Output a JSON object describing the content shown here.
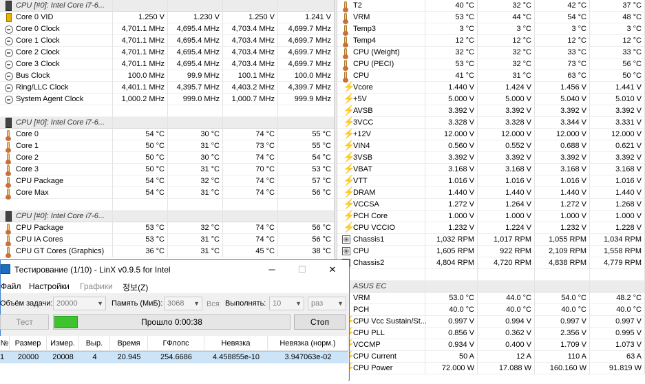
{
  "hwinfo_left": {
    "sections": [
      {
        "header": "CPU [#0]: Intel Core i7-6...",
        "rows": [
          {
            "icon": "vid",
            "label": "Core 0 VID",
            "v": [
              "1.250 V",
              "1.230 V",
              "1.250 V",
              "1.241 V"
            ]
          },
          {
            "icon": "clock",
            "label": "Core 0 Clock",
            "v": [
              "4,701.1 MHz",
              "4,695.4 MHz",
              "4,703.4 MHz",
              "4,699.7 MHz"
            ]
          },
          {
            "icon": "clock",
            "label": "Core 1 Clock",
            "v": [
              "4,701.1 MHz",
              "4,695.4 MHz",
              "4,703.4 MHz",
              "4,699.7 MHz"
            ]
          },
          {
            "icon": "clock",
            "label": "Core 2 Clock",
            "v": [
              "4,701.1 MHz",
              "4,695.4 MHz",
              "4,703.4 MHz",
              "4,699.7 MHz"
            ]
          },
          {
            "icon": "clock",
            "label": "Core 3 Clock",
            "v": [
              "4,701.1 MHz",
              "4,695.4 MHz",
              "4,703.4 MHz",
              "4,699.7 MHz"
            ]
          },
          {
            "icon": "clock",
            "label": "Bus Clock",
            "v": [
              "100.0 MHz",
              "99.9 MHz",
              "100.1 MHz",
              "100.0 MHz"
            ]
          },
          {
            "icon": "clock",
            "label": "Ring/LLC Clock",
            "v": [
              "4,401.1 MHz",
              "4,395.7 MHz",
              "4,403.2 MHz",
              "4,399.7 MHz"
            ]
          },
          {
            "icon": "clock",
            "label": "System Agent Clock",
            "v": [
              "1,000.2 MHz",
              "999.0 MHz",
              "1,000.7 MHz",
              "999.9 MHz"
            ]
          }
        ]
      },
      {
        "header": "CPU [#0]: Intel Core i7-6...",
        "rows": [
          {
            "icon": "therm",
            "label": "Core 0",
            "v": [
              "54 °C",
              "30 °C",
              "74 °C",
              "55 °C"
            ]
          },
          {
            "icon": "therm",
            "label": "Core 1",
            "v": [
              "50 °C",
              "31 °C",
              "73 °C",
              "55 °C"
            ]
          },
          {
            "icon": "therm",
            "label": "Core 2",
            "v": [
              "50 °C",
              "30 °C",
              "74 °C",
              "54 °C"
            ]
          },
          {
            "icon": "therm",
            "label": "Core 3",
            "v": [
              "50 °C",
              "31 °C",
              "70 °C",
              "53 °C"
            ]
          },
          {
            "icon": "therm",
            "label": "CPU Package",
            "v": [
              "54 °C",
              "32 °C",
              "74 °C",
              "57 °C"
            ]
          },
          {
            "icon": "therm",
            "label": "Core Max",
            "v": [
              "54 °C",
              "31 °C",
              "74 °C",
              "56 °C"
            ]
          }
        ]
      },
      {
        "header": "CPU [#0]: Intel Core i7-6...",
        "rows": [
          {
            "icon": "therm",
            "label": "CPU Package",
            "v": [
              "53 °C",
              "32 °C",
              "74 °C",
              "56 °C"
            ]
          },
          {
            "icon": "therm",
            "label": "CPU IA Cores",
            "v": [
              "53 °C",
              "31 °C",
              "74 °C",
              "56 °C"
            ]
          },
          {
            "icon": "therm",
            "label": "CPU GT Cores (Graphics)",
            "v": [
              "36 °C",
              "31 °C",
              "45 °C",
              "38 °C"
            ]
          }
        ]
      }
    ]
  },
  "hwinfo_right": {
    "sections": [
      {
        "header": "",
        "rows": [
          {
            "icon": "therm",
            "label": "T2",
            "v": [
              "40 °C",
              "32 °C",
              "42 °C",
              "37 °C"
            ]
          },
          {
            "icon": "therm",
            "label": "VRM",
            "v": [
              "53 °C",
              "44 °C",
              "54 °C",
              "48 °C"
            ]
          },
          {
            "icon": "therm",
            "label": "Temp3",
            "v": [
              "3 °C",
              "3 °C",
              "3 °C",
              "3 °C"
            ]
          },
          {
            "icon": "therm",
            "label": "Temp4",
            "v": [
              "12 °C",
              "12 °C",
              "12 °C",
              "12 °C"
            ]
          },
          {
            "icon": "therm",
            "label": "CPU (Weight)",
            "v": [
              "32 °C",
              "32 °C",
              "33 °C",
              "33 °C"
            ]
          },
          {
            "icon": "therm",
            "label": "CPU (PECI)",
            "v": [
              "53 °C",
              "32 °C",
              "73 °C",
              "56 °C"
            ]
          },
          {
            "icon": "therm",
            "label": "CPU",
            "v": [
              "41 °C",
              "31 °C",
              "63 °C",
              "50 °C"
            ]
          },
          {
            "icon": "volt",
            "label": "Vcore",
            "v": [
              "1.440 V",
              "1.424 V",
              "1.456 V",
              "1.441 V"
            ]
          },
          {
            "icon": "volt",
            "label": "+5V",
            "v": [
              "5.000 V",
              "5.000 V",
              "5.040 V",
              "5.010 V"
            ]
          },
          {
            "icon": "volt",
            "label": "AVSB",
            "v": [
              "3.392 V",
              "3.392 V",
              "3.392 V",
              "3.392 V"
            ]
          },
          {
            "icon": "volt",
            "label": "3VCC",
            "v": [
              "3.328 V",
              "3.328 V",
              "3.344 V",
              "3.331 V"
            ]
          },
          {
            "icon": "volt",
            "label": "+12V",
            "v": [
              "12.000 V",
              "12.000 V",
              "12.000 V",
              "12.000 V"
            ]
          },
          {
            "icon": "volt",
            "label": "VIN4",
            "v": [
              "0.560 V",
              "0.552 V",
              "0.688 V",
              "0.621 V"
            ]
          },
          {
            "icon": "volt",
            "label": "3VSB",
            "v": [
              "3.392 V",
              "3.392 V",
              "3.392 V",
              "3.392 V"
            ]
          },
          {
            "icon": "volt",
            "label": "VBAT",
            "v": [
              "3.168 V",
              "3.168 V",
              "3.168 V",
              "3.168 V"
            ]
          },
          {
            "icon": "volt",
            "label": "VTT",
            "v": [
              "1.016 V",
              "1.016 V",
              "1.016 V",
              "1.016 V"
            ]
          },
          {
            "icon": "volt",
            "label": "DRAM",
            "v": [
              "1.440 V",
              "1.440 V",
              "1.440 V",
              "1.440 V"
            ]
          },
          {
            "icon": "volt",
            "label": "VCCSA",
            "v": [
              "1.272 V",
              "1.264 V",
              "1.272 V",
              "1.268 V"
            ]
          },
          {
            "icon": "volt",
            "label": "PCH Core",
            "v": [
              "1.000 V",
              "1.000 V",
              "1.000 V",
              "1.000 V"
            ]
          },
          {
            "icon": "volt",
            "label": "CPU VCCIO",
            "v": [
              "1.232 V",
              "1.224 V",
              "1.232 V",
              "1.228 V"
            ]
          },
          {
            "icon": "fan",
            "label": "Chassis1",
            "v": [
              "1,032 RPM",
              "1,017 RPM",
              "1,055 RPM",
              "1,034 RPM"
            ]
          },
          {
            "icon": "fan",
            "label": "CPU",
            "v": [
              "1,605 RPM",
              "922 RPM",
              "2,109 RPM",
              "1,558 RPM"
            ]
          },
          {
            "icon": "fan",
            "label": "Chassis2",
            "v": [
              "4,804 RPM",
              "4,720 RPM",
              "4,838 RPM",
              "4,779 RPM"
            ]
          }
        ]
      },
      {
        "header": "ASUS EC",
        "rows": [
          {
            "icon": "therm",
            "label": "VRM",
            "v": [
              "53.0 °C",
              "44.0 °C",
              "54.0 °C",
              "48.2 °C"
            ]
          },
          {
            "icon": "therm",
            "label": "PCH",
            "v": [
              "40.0 °C",
              "40.0 °C",
              "40.0 °C",
              "40.0 °C"
            ]
          },
          {
            "icon": "volt",
            "label": "CPU Vcc Sustain/St...",
            "v": [
              "0.997 V",
              "0.994 V",
              "0.997 V",
              "0.997 V"
            ]
          },
          {
            "icon": "volt",
            "label": "CPU PLL",
            "v": [
              "0.856 V",
              "0.362 V",
              "2.356 V",
              "0.995 V"
            ]
          },
          {
            "icon": "volt",
            "label": "VCCMP",
            "v": [
              "0.934 V",
              "0.400 V",
              "1.709 V",
              "1.073 V"
            ]
          },
          {
            "icon": "volt",
            "label": "CPU Current",
            "v": [
              "50 A",
              "12 A",
              "110 A",
              "63 A"
            ]
          },
          {
            "icon": "volt",
            "label": "CPU Power",
            "v": [
              "72.000 W",
              "17.088 W",
              "160.160 W",
              "91.819 W"
            ]
          }
        ]
      }
    ]
  },
  "linx": {
    "title": "Тестирование (1/10) - LinX v0.9.5 for Intel",
    "minimize": "─",
    "maximize": "☐",
    "close": "✕",
    "menu": [
      {
        "label": "Файл",
        "disabled": false
      },
      {
        "label": "Настройки",
        "disabled": false
      },
      {
        "label": "Графики",
        "disabled": true
      },
      {
        "label": "정보(Z)",
        "disabled": false
      }
    ],
    "size_label": "Объём задачи:",
    "size_value": "20000",
    "memory_label": "Память (МиБ):",
    "memory_value": "3068",
    "all_label": "Вся",
    "run_label": "Выполнять:",
    "run_value": "10",
    "run_unit": "раз",
    "test_button": "Тест",
    "stop_button": "Стоп",
    "progress_text": "Прошло 0:00:38",
    "progress_fraction": 0.1,
    "columns": [
      "№",
      "Размер",
      "Измер.",
      "Выр.",
      "Время",
      "ГФлопс",
      "Невязка",
      "Невязка (норм.)"
    ],
    "rows": [
      [
        "1",
        "20000",
        "20008",
        "4",
        "20.945",
        "254.6686",
        "4.458855e-10",
        "3.947063e-02"
      ]
    ]
  },
  "colors": {
    "accent": "#3a7fcf",
    "progress": "#3ec22e",
    "selection": "#cce4f7"
  }
}
